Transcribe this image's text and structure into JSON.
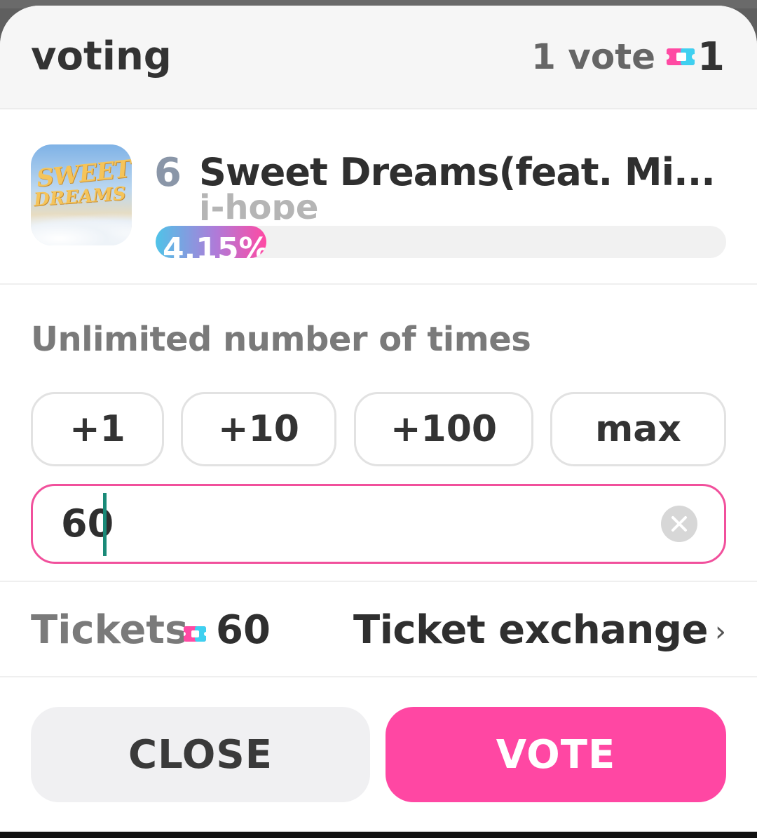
{
  "header": {
    "title": "voting",
    "vote_unit_label": "1 vote",
    "vote_cost": "1",
    "ticket_icon": "ticket-icon"
  },
  "song": {
    "rank": "6",
    "title": "Sweet Dreams(feat. Mi...",
    "artist": "j-hope",
    "percent_label": "4.15%",
    "percent_value": 4.15,
    "album_art": {
      "line1": "SWEET",
      "line2": "DREAMS"
    }
  },
  "vote_panel": {
    "limit_text": "Unlimited number of times",
    "quick_buttons": [
      "+1",
      "+10",
      "+100",
      "max"
    ],
    "input_value": "60",
    "clear_icon": "clear-icon"
  },
  "tickets": {
    "label": "Tickets",
    "value": "60",
    "exchange_label": "Ticket exchange",
    "chevron": "›"
  },
  "actions": {
    "close_label": "CLOSE",
    "vote_label": "VOTE"
  },
  "colors": {
    "accent_pink": "#ff47a3",
    "input_border": "#f1509c",
    "progress_start": "#4fc3e8",
    "progress_end": "#ff4aa3"
  }
}
